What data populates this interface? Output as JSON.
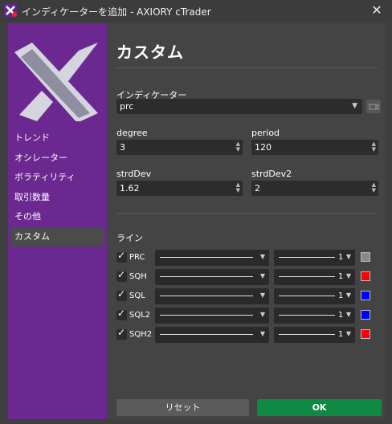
{
  "window": {
    "title": "インディケーターを追加 - AXIORY cTrader",
    "close_glyph": "✕"
  },
  "sidebar": {
    "items": [
      {
        "label": "トレンド",
        "active": false
      },
      {
        "label": "オシレーター",
        "active": false
      },
      {
        "label": "ボラティリティ",
        "active": false
      },
      {
        "label": "取引数量",
        "active": false
      },
      {
        "label": "その他",
        "active": false
      },
      {
        "label": "カスタム",
        "active": true
      }
    ]
  },
  "main": {
    "heading": "カスタム",
    "indicator": {
      "label": "インディケーター",
      "value": "prc"
    },
    "params": {
      "degree": {
        "label": "degree",
        "value": "3"
      },
      "period": {
        "label": "period",
        "value": "120"
      },
      "strdDev": {
        "label": "strdDev",
        "value": "1.62"
      },
      "strdDev2": {
        "label": "strdDev2",
        "value": "2"
      }
    },
    "lines_label": "ライン",
    "lines": [
      {
        "name": "PRC",
        "checked": true,
        "width": "1",
        "color": "#888888"
      },
      {
        "name": "SQH",
        "checked": true,
        "width": "1",
        "color": "#ff0000"
      },
      {
        "name": "SQL",
        "checked": true,
        "width": "1",
        "color": "#0000ff"
      },
      {
        "name": "SQL2",
        "checked": true,
        "width": "1",
        "color": "#0000ff"
      },
      {
        "name": "SQH2",
        "checked": true,
        "width": "1",
        "color": "#ff0000"
      }
    ],
    "buttons": {
      "reset": "リセット",
      "ok": "OK"
    }
  },
  "colors": {
    "sidebar": "#6a2890",
    "ok": "#0f8a45",
    "accent_logo": "#c9c9d6"
  }
}
